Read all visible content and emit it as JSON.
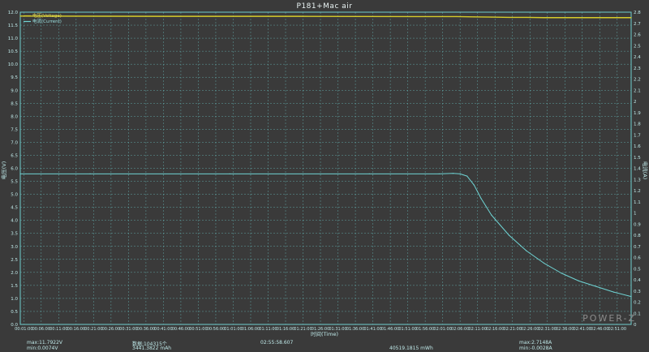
{
  "window": {
    "title": "P181+Mac air"
  },
  "chart_data": {
    "type": "line",
    "title": "P181+Mac air",
    "xlabel": "时间(Time)",
    "ylabel": "电压(V)",
    "y2label": "电流(A)",
    "ylim": [
      0,
      12
    ],
    "y2lim": [
      0,
      2.8
    ],
    "yticks": [
      "0.0",
      "0.5",
      "1.0",
      "1.5",
      "2.0",
      "2.5",
      "3.0",
      "3.5",
      "4.0",
      "4.5",
      "5.0",
      "5.5",
      "6.0",
      "6.5",
      "7.0",
      "7.5",
      "8.0",
      "8.5",
      "9.0",
      "9.5",
      "10.0",
      "10.5",
      "11.0",
      "11.5",
      "12.0"
    ],
    "y2ticks": [
      "0",
      "0.1",
      "0.2",
      "0.3",
      "0.4",
      "0.5",
      "0.6",
      "0.7",
      "0.8",
      "0.9",
      "1",
      "1.1",
      "1.2",
      "1.3",
      "1.4",
      "1.5",
      "1.6",
      "1.7",
      "1.8",
      "1.9",
      "2",
      "2.1",
      "2.2",
      "2.3",
      "2.4",
      "2.5",
      "2.6",
      "2.7",
      "2.8"
    ],
    "xticks": [
      "00:01:00",
      "00:06:00",
      "00:11:00",
      "00:16:00",
      "00:21:00",
      "00:26:00",
      "00:31:00",
      "00:36:00",
      "00:41:00",
      "00:46:00",
      "00:51:00",
      "00:56:00",
      "01:01:00",
      "01:06:00",
      "01:11:00",
      "01:16:00",
      "01:21:00",
      "01:26:00",
      "01:31:00",
      "01:36:00",
      "01:41:00",
      "01:46:00",
      "01:51:00",
      "01:56:00",
      "02:01:00",
      "02:06:00",
      "02:11:00",
      "02:16:00",
      "02:21:00",
      "02:26:00",
      "02:31:00",
      "02:36:00",
      "02:41:00",
      "02:46:00",
      "02:51:00"
    ],
    "xlim_minutes": [
      0,
      175
    ],
    "legend": [
      "电压(Voltage)",
      "电流(Current)"
    ],
    "legend_position": "top-left",
    "grid": true,
    "series": [
      {
        "name": "电压(Voltage)",
        "axis": "left",
        "color": "#d6cc2a",
        "x": [
          0,
          40,
          80,
          120,
          125,
          130,
          135,
          140,
          145,
          150,
          155,
          160,
          165,
          170,
          175
        ],
        "y": [
          11.85,
          11.84,
          11.84,
          11.83,
          11.83,
          11.82,
          11.81,
          11.8,
          11.8,
          11.79,
          11.79,
          11.79,
          11.79,
          11.79,
          11.79
        ]
      },
      {
        "name": "电流(Current)",
        "axis": "right",
        "color": "#6fd4d4",
        "x": [
          0,
          20,
          60,
          100,
          120,
          124,
          126,
          128,
          130,
          132,
          135,
          140,
          145,
          150,
          155,
          160,
          165,
          170,
          175
        ],
        "y": [
          1.35,
          1.35,
          1.35,
          1.35,
          1.35,
          1.355,
          1.35,
          1.33,
          1.25,
          1.13,
          0.98,
          0.8,
          0.66,
          0.55,
          0.46,
          0.39,
          0.34,
          0.29,
          0.25
        ]
      }
    ]
  },
  "stats": {
    "vmax": "max:11.7922V",
    "vmin": "min:0.0074V",
    "count": "数据:104315个",
    "capacity": "3441.3822 mAh",
    "duration": "02:55:58.607",
    "energy": "40519.1815 mWh",
    "imax": "max:2.7148A",
    "imin": "min:-0.0028A"
  },
  "watermark": "POWER-Z",
  "colors": {
    "background": "#3a3a3a",
    "grid": "#6fcfcf",
    "axis": "#6fcfcf",
    "voltage": "#d6cc2a",
    "current": "#6fd4d4"
  }
}
